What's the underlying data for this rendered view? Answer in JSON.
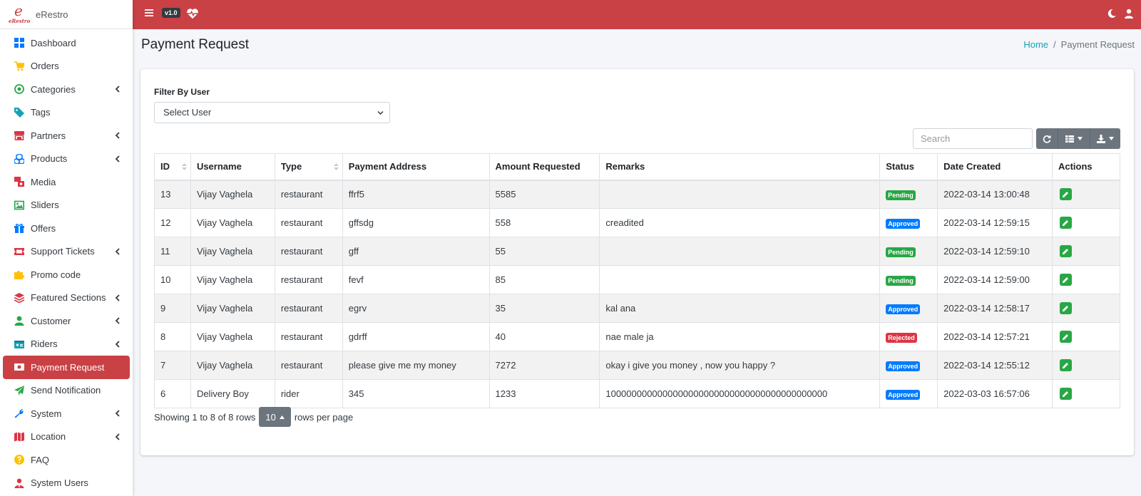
{
  "brand": {
    "name": "eRestro",
    "logo_letter": "e",
    "logo_sub": "eRestro"
  },
  "topbar": {
    "version": "v1.0",
    "bg": "#c94145"
  },
  "sidebar": {
    "items": [
      {
        "label": "Dashboard",
        "icon": "dashboard-icon",
        "color": "#007bff",
        "chevron": false
      },
      {
        "label": "Orders",
        "icon": "cart-icon",
        "color": "#ffc107",
        "chevron": false
      },
      {
        "label": "Categories",
        "icon": "bullseye-icon",
        "color": "#28a745",
        "chevron": true
      },
      {
        "label": "Tags",
        "icon": "tag-icon",
        "color": "#17a2b8",
        "chevron": false
      },
      {
        "label": "Partners",
        "icon": "store-icon",
        "color": "#dc3545",
        "chevron": true
      },
      {
        "label": "Products",
        "icon": "cubes-icon",
        "color": "#007bff",
        "chevron": true
      },
      {
        "label": "Media",
        "icon": "photo-video-icon",
        "color": "#dc3545",
        "chevron": false
      },
      {
        "label": "Sliders",
        "icon": "image-icon",
        "color": "#28a745",
        "chevron": false
      },
      {
        "label": "Offers",
        "icon": "gift-icon",
        "color": "#007bff",
        "chevron": false
      },
      {
        "label": "Support Tickets",
        "icon": "ticket-icon",
        "color": "#dc3545",
        "chevron": true
      },
      {
        "label": "Promo code",
        "icon": "puzzle-icon",
        "color": "#ffc107",
        "chevron": false
      },
      {
        "label": "Featured Sections",
        "icon": "layers-icon",
        "color": "#dc3545",
        "chevron": true
      },
      {
        "label": "Customer",
        "icon": "user-icon",
        "color": "#28a745",
        "chevron": true
      },
      {
        "label": "Riders",
        "icon": "id-card-icon",
        "color": "#17a2b8",
        "chevron": true
      },
      {
        "label": "Payment Request",
        "icon": "money-bill-icon",
        "color": "#ffffff",
        "chevron": false,
        "active": true
      },
      {
        "label": "Send Notification",
        "icon": "paper-plane-icon",
        "color": "#28a745",
        "chevron": false
      },
      {
        "label": "System",
        "icon": "wrench-icon",
        "color": "#007bff",
        "chevron": true
      },
      {
        "label": "Location",
        "icon": "map-icon",
        "color": "#dc3545",
        "chevron": true
      },
      {
        "label": "FAQ",
        "icon": "question-icon",
        "color": "#ffc107",
        "chevron": false
      },
      {
        "label": "System Users",
        "icon": "user-tie-icon",
        "color": "#dc3545",
        "chevron": false
      }
    ]
  },
  "page": {
    "title": "Payment Request"
  },
  "breadcrumb": {
    "home": "Home",
    "current": "Payment Request"
  },
  "filter": {
    "label": "Filter By User",
    "selected": "Select User"
  },
  "search": {
    "placeholder": "Search"
  },
  "table": {
    "columns": [
      "ID",
      "Username",
      "Type",
      "Payment Address",
      "Amount Requested",
      "Remarks",
      "Status",
      "Date Created",
      "Actions"
    ],
    "rows": [
      {
        "id": "13",
        "username": "Vijay Vaghela",
        "type": "restaurant",
        "address": "ffrf5",
        "amount": "5585",
        "remarks": "",
        "status": "Pending",
        "date": "2022-03-14 13:00:48"
      },
      {
        "id": "12",
        "username": "Vijay Vaghela",
        "type": "restaurant",
        "address": "gffsdg",
        "amount": "558",
        "remarks": "creadited",
        "status": "Approved",
        "date": "2022-03-14 12:59:15"
      },
      {
        "id": "11",
        "username": "Vijay Vaghela",
        "type": "restaurant",
        "address": "gff",
        "amount": "55",
        "remarks": "",
        "status": "Pending",
        "date": "2022-03-14 12:59:10"
      },
      {
        "id": "10",
        "username": "Vijay Vaghela",
        "type": "restaurant",
        "address": "fevf",
        "amount": "85",
        "remarks": "",
        "status": "Pending",
        "date": "2022-03-14 12:59:00"
      },
      {
        "id": "9",
        "username": "Vijay Vaghela",
        "type": "restaurant",
        "address": "egrv",
        "amount": "35",
        "remarks": "kal ana",
        "status": "Approved",
        "date": "2022-03-14 12:58:17"
      },
      {
        "id": "8",
        "username": "Vijay Vaghela",
        "type": "restaurant",
        "address": "gdrff",
        "amount": "40",
        "remarks": "nae male ja",
        "status": "Rejected",
        "date": "2022-03-14 12:57:21"
      },
      {
        "id": "7",
        "username": "Vijay Vaghela",
        "type": "restaurant",
        "address": "please give me my money",
        "amount": "7272",
        "remarks": "okay i give you money , now you happy ?",
        "status": "Approved",
        "date": "2022-03-14 12:55:12"
      },
      {
        "id": "6",
        "username": "Delivery Boy",
        "type": "rider",
        "address": "345",
        "amount": "1233",
        "remarks": "1000000000000000000000000000000000000000000",
        "status": "Approved",
        "date": "2022-03-03 16:57:06"
      }
    ]
  },
  "pagination": {
    "showing": "Showing 1 to 8 of 8 rows",
    "page_size": "10",
    "suffix": "rows per page"
  }
}
